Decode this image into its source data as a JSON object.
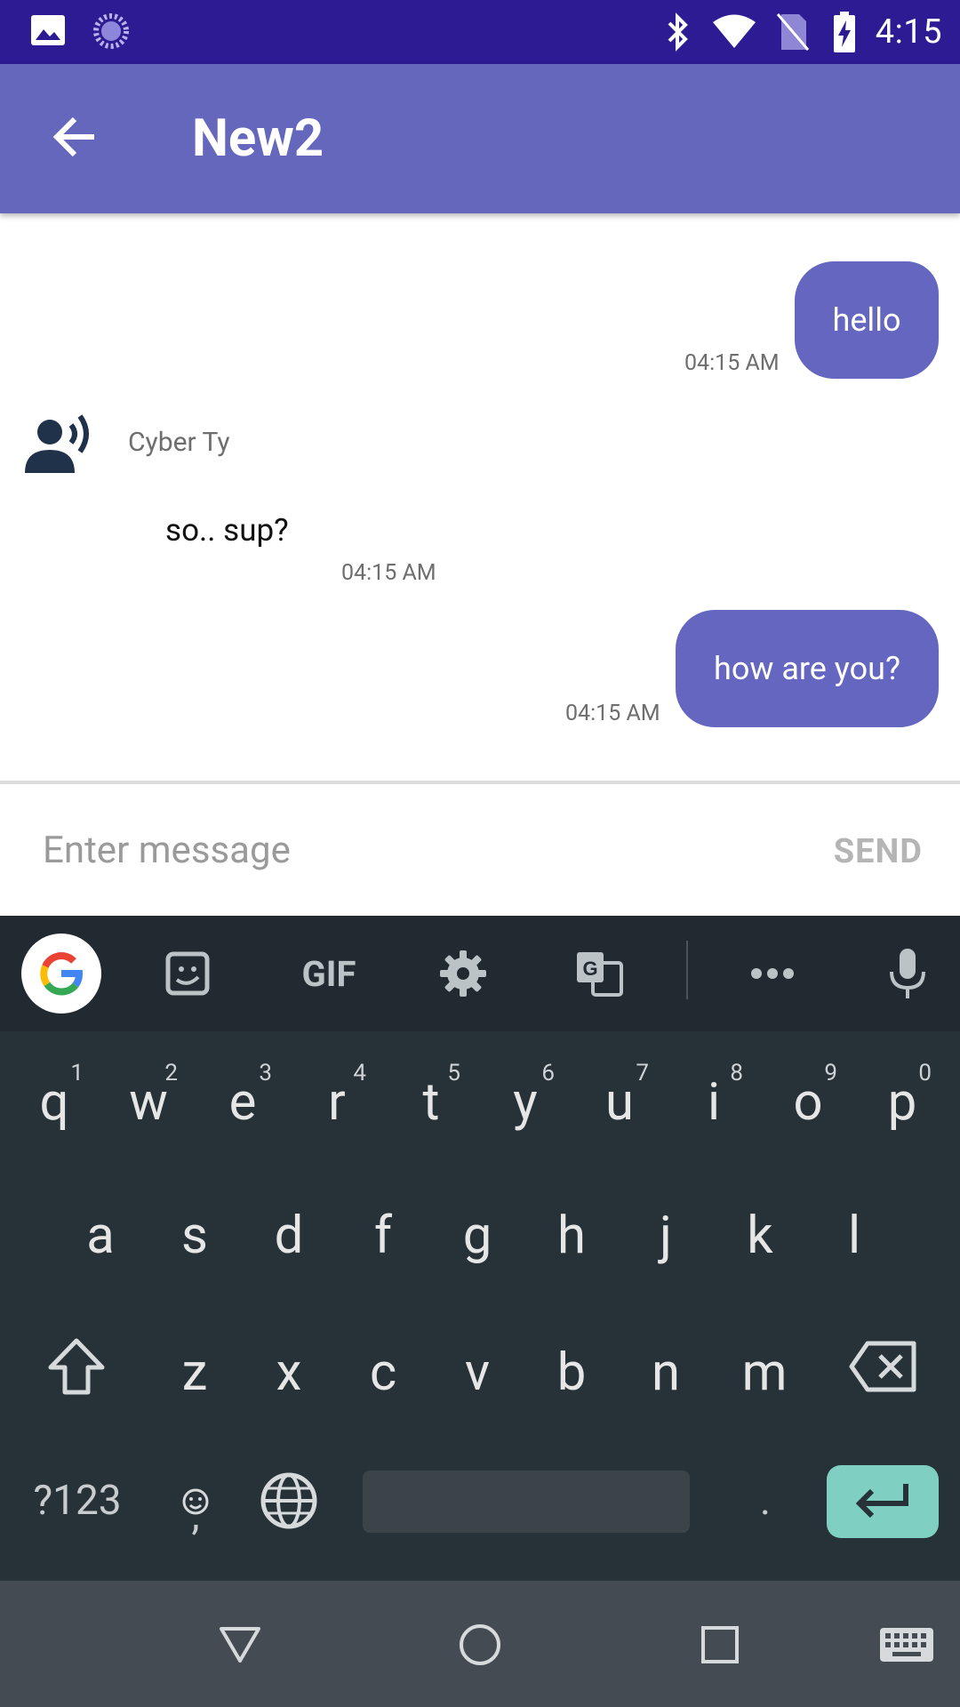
{
  "status_bar": {
    "time": "4:15",
    "icons": [
      "image-icon",
      "loading-icon",
      "bluetooth-icon",
      "wifi-icon",
      "no-sim-icon",
      "battery-charging-icon"
    ]
  },
  "app_bar": {
    "title": "New2",
    "back_icon": "arrow-back-icon",
    "color": "#6567bd"
  },
  "messages": [
    {
      "direction": "outgoing",
      "text": "hello",
      "time": "04:15 AM"
    },
    {
      "direction": "incoming",
      "sender": "Cyber Ty",
      "text": "so.. sup?",
      "time": "04:15 AM",
      "avatar_icon": "record-voice-icon"
    },
    {
      "direction": "outgoing",
      "text": "how are you?",
      "time": "04:15 AM"
    }
  ],
  "input": {
    "placeholder": "Enter message",
    "value": "",
    "send_label": "SEND"
  },
  "keyboard": {
    "toolbar": [
      "google-icon",
      "sticker-icon",
      "gif-label",
      "gear-icon",
      "translate-icon",
      "more-icon",
      "mic-icon"
    ],
    "gif_label": "GIF",
    "row1": [
      {
        "k": "q",
        "h": "1"
      },
      {
        "k": "w",
        "h": "2"
      },
      {
        "k": "e",
        "h": "3"
      },
      {
        "k": "r",
        "h": "4"
      },
      {
        "k": "t",
        "h": "5"
      },
      {
        "k": "y",
        "h": "6"
      },
      {
        "k": "u",
        "h": "7"
      },
      {
        "k": "i",
        "h": "8"
      },
      {
        "k": "o",
        "h": "9"
      },
      {
        "k": "p",
        "h": "0"
      }
    ],
    "row2": [
      "a",
      "s",
      "d",
      "f",
      "g",
      "h",
      "j",
      "k",
      "l"
    ],
    "row3": [
      "z",
      "x",
      "c",
      "v",
      "b",
      "n",
      "m"
    ],
    "symbols_label": "?123",
    "comma_label": ",",
    "period_label": ".",
    "accent_color": "#7fcfc3"
  },
  "nav_bar": {
    "icons": [
      "back-triangle-icon",
      "home-circle-icon",
      "recents-square-icon",
      "keyboard-icon"
    ]
  }
}
